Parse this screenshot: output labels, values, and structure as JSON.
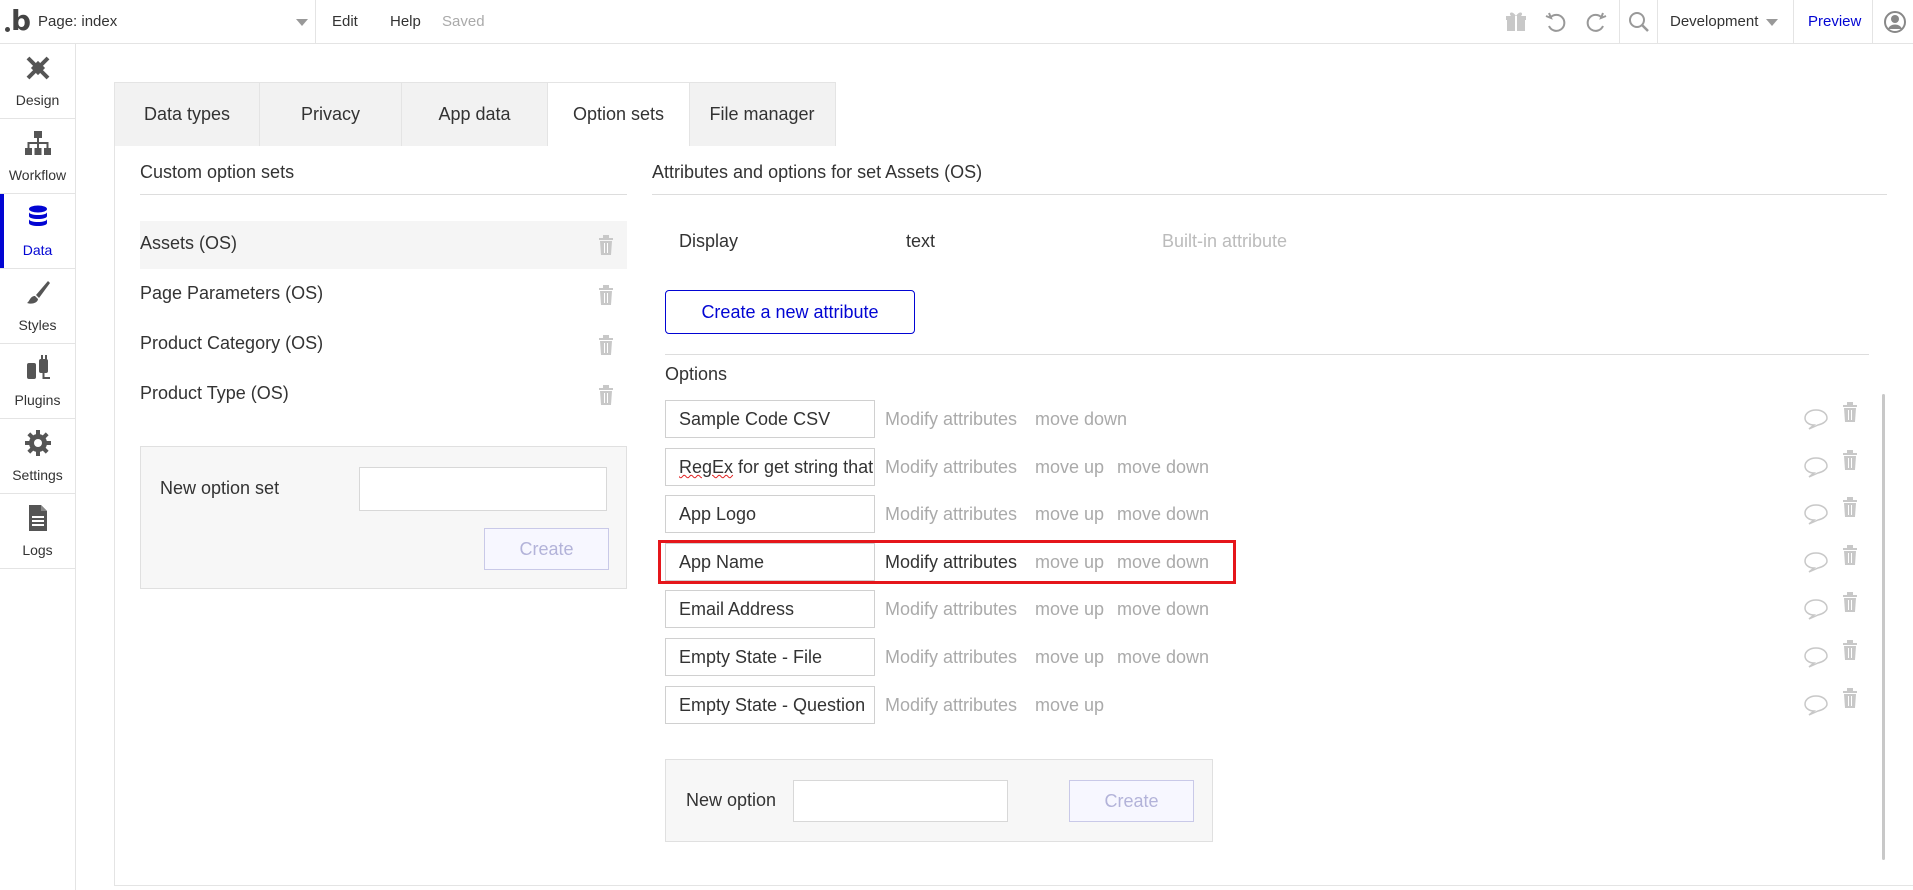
{
  "topbar": {
    "page_select": "Page: index",
    "menu": {
      "edit": "Edit",
      "help": "Help"
    },
    "saved": "Saved",
    "icons": [
      "gift-icon",
      "undo-icon",
      "redo-icon",
      "search-icon",
      "user-icon"
    ],
    "environment": "Development",
    "preview": "Preview"
  },
  "sidebar": {
    "items": [
      {
        "label": "Design",
        "icon": "design-icon"
      },
      {
        "label": "Workflow",
        "icon": "workflow-icon"
      },
      {
        "label": "Data",
        "icon": "database-icon",
        "active": true
      },
      {
        "label": "Styles",
        "icon": "brush-icon"
      },
      {
        "label": "Plugins",
        "icon": "plug-icon"
      },
      {
        "label": "Settings",
        "icon": "gear-icon"
      },
      {
        "label": "Logs",
        "icon": "document-icon"
      }
    ]
  },
  "tabs": [
    {
      "label": "Data types"
    },
    {
      "label": "Privacy"
    },
    {
      "label": "App data"
    },
    {
      "label": "Option sets",
      "active": true
    },
    {
      "label": "File manager"
    }
  ],
  "option_sets": {
    "title": "Custom option sets",
    "items": [
      {
        "name": "Assets (OS)",
        "selected": true
      },
      {
        "name": "Page Parameters (OS)"
      },
      {
        "name": "Product Category (OS)"
      },
      {
        "name": "Product Type (OS)"
      }
    ],
    "new_label": "New option set",
    "new_value": "",
    "create_label": "Create"
  },
  "attributes": {
    "title": "Attributes and options for set Assets (OS)",
    "display_label": "Display",
    "display_type": "text",
    "display_note": "Built-in attribute",
    "create_attribute_label": "Create a new attribute"
  },
  "options": {
    "title": "Options",
    "modify_label": "Modify attributes",
    "move_up_label": "move up",
    "move_down_label": "move down",
    "items": [
      {
        "name": "Sample Code CSV"
      },
      {
        "name_part1": "RegEx",
        "name_part2": " for get string that"
      },
      {
        "name": "App Logo"
      },
      {
        "name": "App Name",
        "highlighted": true
      },
      {
        "name": "Email Address"
      },
      {
        "name": "Empty State - File"
      },
      {
        "name": "Empty State - Question"
      }
    ],
    "new_label": "New option",
    "new_value": "",
    "create_label": "Create"
  },
  "colors": {
    "accent": "#0205d3",
    "highlight": "#e5161b",
    "muted": "#aaaaaa"
  }
}
